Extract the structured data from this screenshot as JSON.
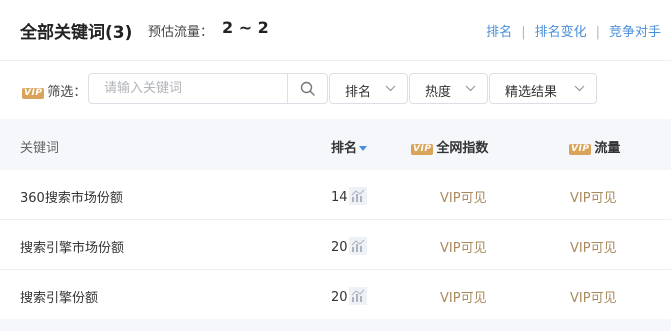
{
  "header": {
    "title": "全部关键词(3)",
    "traffic_label": "预估流量：",
    "traffic_value": "2 ~ 2",
    "links": [
      "排名",
      "排名变化",
      "竞争对手"
    ],
    "separator": "|"
  },
  "filter": {
    "vip_badge": "VIP",
    "label": "筛选：",
    "search_placeholder": "请输入关键词",
    "search_value": "",
    "dropdowns": [
      "排名",
      "热度",
      "精选结果"
    ]
  },
  "table": {
    "columns": {
      "keyword": "关键词",
      "rank": "排名",
      "index": "全网指数",
      "traffic": "流量",
      "vip_badge": "VIP"
    },
    "rows": [
      {
        "keyword": "360搜索市场份额",
        "rank": "14",
        "index": "VIP可见",
        "traffic": "VIP可见"
      },
      {
        "keyword": "搜索引擎市场份额",
        "rank": "20",
        "index": "VIP可见",
        "traffic": "VIP可见"
      },
      {
        "keyword": "搜索引擎份额",
        "rank": "20",
        "index": "VIP可见",
        "traffic": "VIP可见"
      }
    ]
  },
  "colors": {
    "link": "#4a8fd7",
    "vip_text": "#a98a5e",
    "vip_badge": "#d9a35a",
    "header_bg": "#f5f7fb"
  },
  "icons": [
    "search-icon",
    "chevron-down-icon",
    "sort-down-icon",
    "trend-chart-icon"
  ]
}
